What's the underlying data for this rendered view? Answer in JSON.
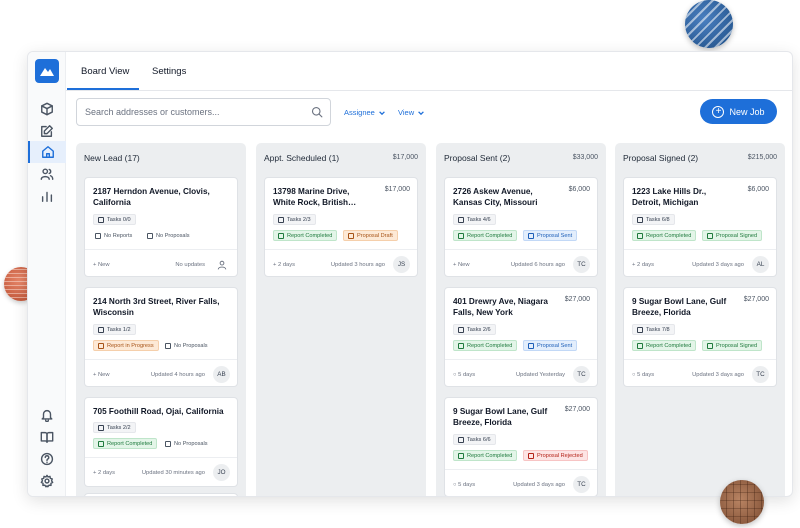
{
  "tabs": {
    "board_view": "Board View",
    "settings": "Settings"
  },
  "search": {
    "placeholder": "Search addresses or customers..."
  },
  "filters": {
    "assignee": "Assignee",
    "view": "View"
  },
  "new_job": {
    "label": "New Job"
  },
  "columns": [
    {
      "title": "New Lead (17)",
      "total": "",
      "cards": [
        {
          "address": "2187 Herndon Avenue, Clovis, California",
          "price": "",
          "tasks": "Tasks 0/0",
          "status1": "No Reports",
          "status2": "No Proposals",
          "tag": "+ New",
          "time": "No updates",
          "avatar": ""
        },
        {
          "address": "214 North 3rd Street, River Falls, Wisconsin",
          "price": "",
          "tasks": "Tasks 1/2",
          "status1": "Report in Progress",
          "status2": "No Proposals",
          "tag": "+ New",
          "time": "Updated 4 hours ago",
          "avatar": "AB"
        },
        {
          "address": "705 Foothill Road, Ojai, California",
          "price": "",
          "tasks": "Tasks 2/2",
          "status1": "Report Completed",
          "status2": "No Proposals",
          "tag": "+ 2 days",
          "time": "Updated 30 minutes ago",
          "avatar": "JO"
        }
      ]
    },
    {
      "title": "Appt. Scheduled (1)",
      "total": "$17,000",
      "cards": [
        {
          "address": "13798 Marine Drive, White Rock, British…",
          "price": "$17,000",
          "tasks": "Tasks 2/3",
          "status1": "Report Completed",
          "status2": "Proposal Draft",
          "tag": "+ 2 days",
          "time": "Updated 3 hours ago",
          "avatar": "JS"
        }
      ]
    },
    {
      "title": "Proposal Sent (2)",
      "total": "$33,000",
      "cards": [
        {
          "address": "2726 Askew Avenue, Kansas City, Missouri",
          "price": "$6,000",
          "tasks": "Tasks 4/6",
          "status1": "Report Completed",
          "status2": "Proposal Sent",
          "tag": "+ New",
          "time": "Updated 6 hours ago",
          "avatar": "TC"
        },
        {
          "address": "401 Drewry Ave, Niagara Falls, New York",
          "price": "$27,000",
          "tasks": "Tasks 2/6",
          "status1": "Report Completed",
          "status2": "Proposal Sent",
          "tag": "○ 5 days",
          "time": "Updated Yesterday",
          "avatar": "TC"
        },
        {
          "address": "9 Sugar Bowl Lane, Gulf Breeze, Florida",
          "price": "$27,000",
          "tasks": "Tasks 6/6",
          "status1": "Report Completed",
          "status2": "Proposal Rejected",
          "tag": "○ 5 days",
          "time": "Updated 3 days ago",
          "avatar": "TC"
        }
      ]
    },
    {
      "title": "Proposal Signed (2)",
      "total": "$215,000",
      "cards": [
        {
          "address": "1223 Lake Hills Dr., Detroit, Michigan",
          "price": "$6,000",
          "tasks": "Tasks 6/8",
          "status1": "Report Completed",
          "status2": "Proposal Signed",
          "tag": "+ 2 days",
          "time": "Updated 3 days ago",
          "avatar": "AL"
        },
        {
          "address": "9 Sugar Bowl Lane, Gulf Breeze, Florida",
          "price": "$27,000",
          "tasks": "Tasks 7/8",
          "status1": "Report Completed",
          "status2": "Proposal Signed",
          "tag": "○ 5 days",
          "time": "Updated 3 days ago",
          "avatar": "TC"
        }
      ]
    }
  ],
  "colors": {
    "accent": "#1e6fd9",
    "column_bg": "#eceef0"
  },
  "icons": [
    "logo-icon",
    "box-icon",
    "edit-icon",
    "home-icon",
    "users-icon",
    "chart-icon",
    "bell-icon",
    "book-icon",
    "help-icon",
    "gear-icon",
    "search-icon",
    "chevron-down-icon",
    "plus-circle-icon",
    "task-icon",
    "document-icon",
    "user-icon"
  ]
}
